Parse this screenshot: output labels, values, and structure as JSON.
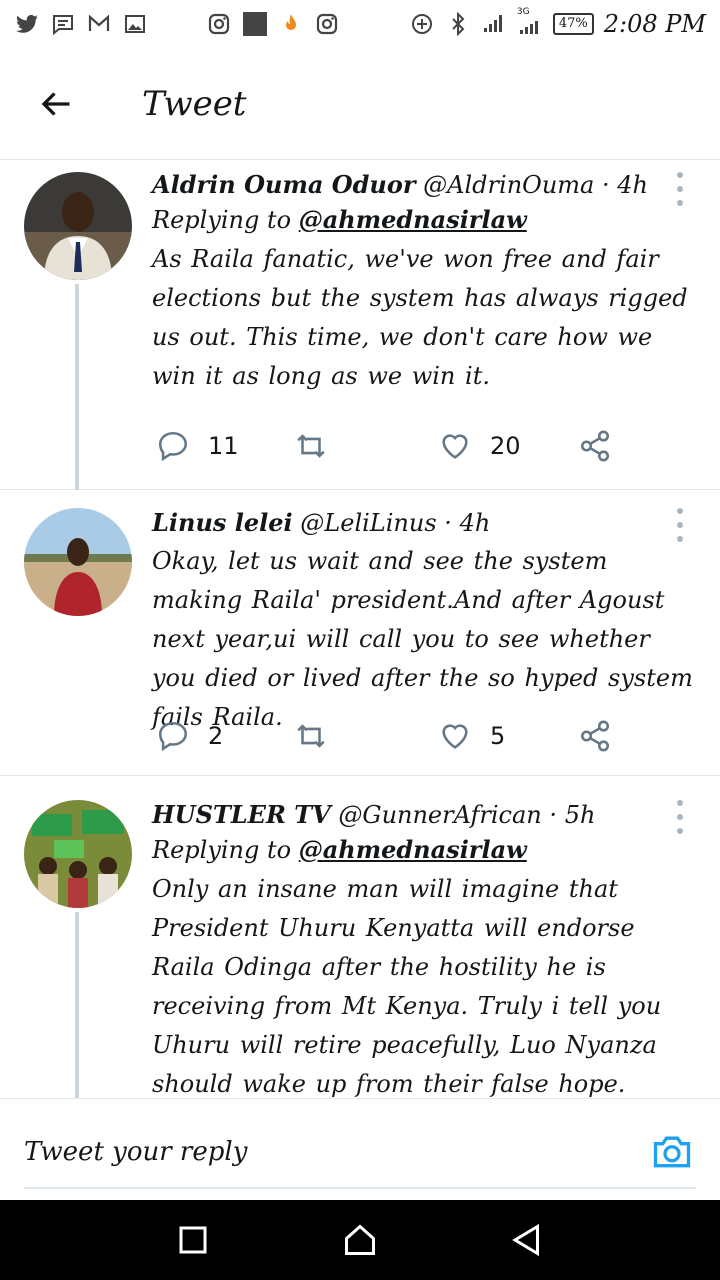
{
  "status_bar": {
    "left_icons": [
      "twitter-icon",
      "message-icon",
      "gmail-icon",
      "gallery-icon",
      "instagram-icon",
      "app-icon",
      "fire-icon",
      "instagram-icon"
    ],
    "network": "3G",
    "battery": "47%",
    "time": "2:08 PM"
  },
  "header": {
    "title": "Tweet"
  },
  "tweets": [
    {
      "name": "Aldrin Ouma Oduor",
      "handle": "@AldrinOuma",
      "separator": "·",
      "time": "4h",
      "replying_label": "Replying to",
      "replying_to": "@ahmednasirlaw",
      "text": "As Raila fanatic, we've won free and fair elections but the system has always rigged us out. This time, we don't care how we win it as long as we win it.",
      "replies": "11",
      "retweets": "",
      "likes": "20"
    },
    {
      "name": "Linus lelei",
      "handle": "@LeliLinus",
      "separator": "·",
      "time": "4h",
      "replying_label": "",
      "replying_to": "",
      "text": "Okay, let us wait and see the system making Raila' president.And after Agoust next year,ui will call you to see whether you died or lived after the so hyped system fails Raila.",
      "replies": "2",
      "retweets": "",
      "likes": "5"
    },
    {
      "name": "HUSTLER TV",
      "handle": "@GunnerAfrican",
      "separator": "·",
      "time": "5h",
      "replying_label": "Replying to",
      "replying_to": "@ahmednasirlaw",
      "text": "Only an insane man will imagine that President Uhuru Kenyatta will endorse Raila Odinga after the hostility he is receiving from Mt Kenya. Truly i tell you Uhuru will retire peacefully, Luo Nyanza should wake up from their false hope."
    }
  ],
  "reply_bar": {
    "placeholder": "Tweet your reply"
  },
  "colors": {
    "accent": "#1da1f2",
    "icon_gray": "#657786",
    "divider": "#e1e8ed"
  }
}
